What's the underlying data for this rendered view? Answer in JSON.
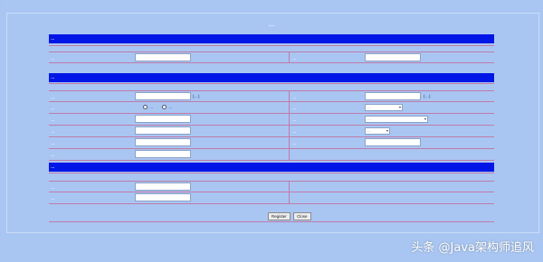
{
  "app": {
    "topbar_text": "…",
    "page_title": "…"
  },
  "section1": {
    "header": "…",
    "left_label": "…",
    "right_label": "…",
    "left_value": "",
    "right_value": ""
  },
  "section2": {
    "header": "…",
    "rows": [
      {
        "left_label": "…",
        "left_hint": "(…)",
        "right_label": "…",
        "right_hint": "(…)"
      },
      {
        "left_label": "…",
        "radio_a": "…",
        "radio_b": "…",
        "right_label": "…",
        "right_select": "…"
      },
      {
        "left_label": "…",
        "right_label": "…",
        "right_select": "…"
      },
      {
        "left_label": "…",
        "right_label": "…",
        "right_select": "…"
      },
      {
        "left_label": "…",
        "right_label": "…"
      },
      {
        "left_label": "…"
      }
    ]
  },
  "section3": {
    "header": "…",
    "rows": [
      {
        "label": "…"
      },
      {
        "label": "…"
      }
    ]
  },
  "actions": {
    "register_label": "Register",
    "close_label": "Close"
  },
  "watermark": "头条 @Java架构师追风",
  "colors": {
    "background": "#a9c6f2",
    "header_bar": "#0016e6",
    "row_border": "#c07aa8"
  }
}
